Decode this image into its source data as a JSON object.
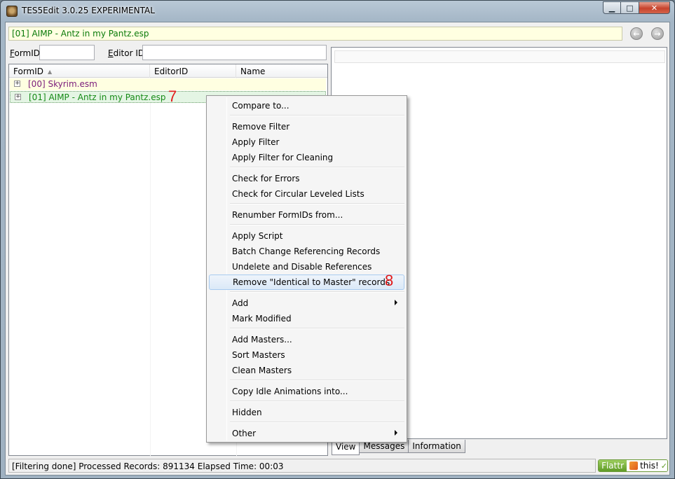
{
  "window": {
    "title": "TES5Edit 3.0.25 EXPERIMENTAL",
    "controls": {
      "minimize": "▁",
      "maximize": "□",
      "close": "✕"
    }
  },
  "pathbar": {
    "text": "[01] AIMP - Antz in my Pantz.esp"
  },
  "nav": {
    "back": "←",
    "forward": "→"
  },
  "filters": {
    "formid_label_ul": "F",
    "formid_label_rest": "ormID",
    "editorid_label_ul": "E",
    "editorid_label_rest": "ditor ID",
    "formid_value": "",
    "editorid_value": ""
  },
  "tree": {
    "columns": [
      "FormID",
      "EditorID",
      "Name"
    ],
    "sort_indicator": "▲",
    "rows": [
      {
        "expander": "+",
        "label": "[00] Skyrim.esm"
      },
      {
        "expander": "+",
        "label": "[01] AIMP - Antz in my Pantz.esp"
      }
    ]
  },
  "annotations": {
    "step7": "7",
    "step8": "8"
  },
  "context_menu": {
    "items": [
      "Compare to...",
      "Remove Filter",
      "Apply Filter",
      "Apply Filter for Cleaning",
      "Check for Errors",
      "Check for Circular Leveled Lists",
      "Renumber FormIDs from...",
      "Apply Script",
      "Batch Change Referencing Records",
      "Undelete and Disable References",
      "Remove \"Identical to Master\" records",
      "Add",
      "Mark Modified",
      "Add Masters...",
      "Sort Masters",
      "Clean Masters",
      "Copy Idle Animations into...",
      "Hidden",
      "Other"
    ]
  },
  "tabs": [
    "View",
    "Messages",
    "Information"
  ],
  "status": {
    "text": "[Filtering done]  Processed Records: 891134 Elapsed Time: 00:03"
  },
  "flattr": {
    "left": "Flattr",
    "right": "this!"
  },
  "colors": {
    "esm_text": "#7a1a7a",
    "esp_text": "#168a16",
    "annotation": "#e21a1a"
  }
}
